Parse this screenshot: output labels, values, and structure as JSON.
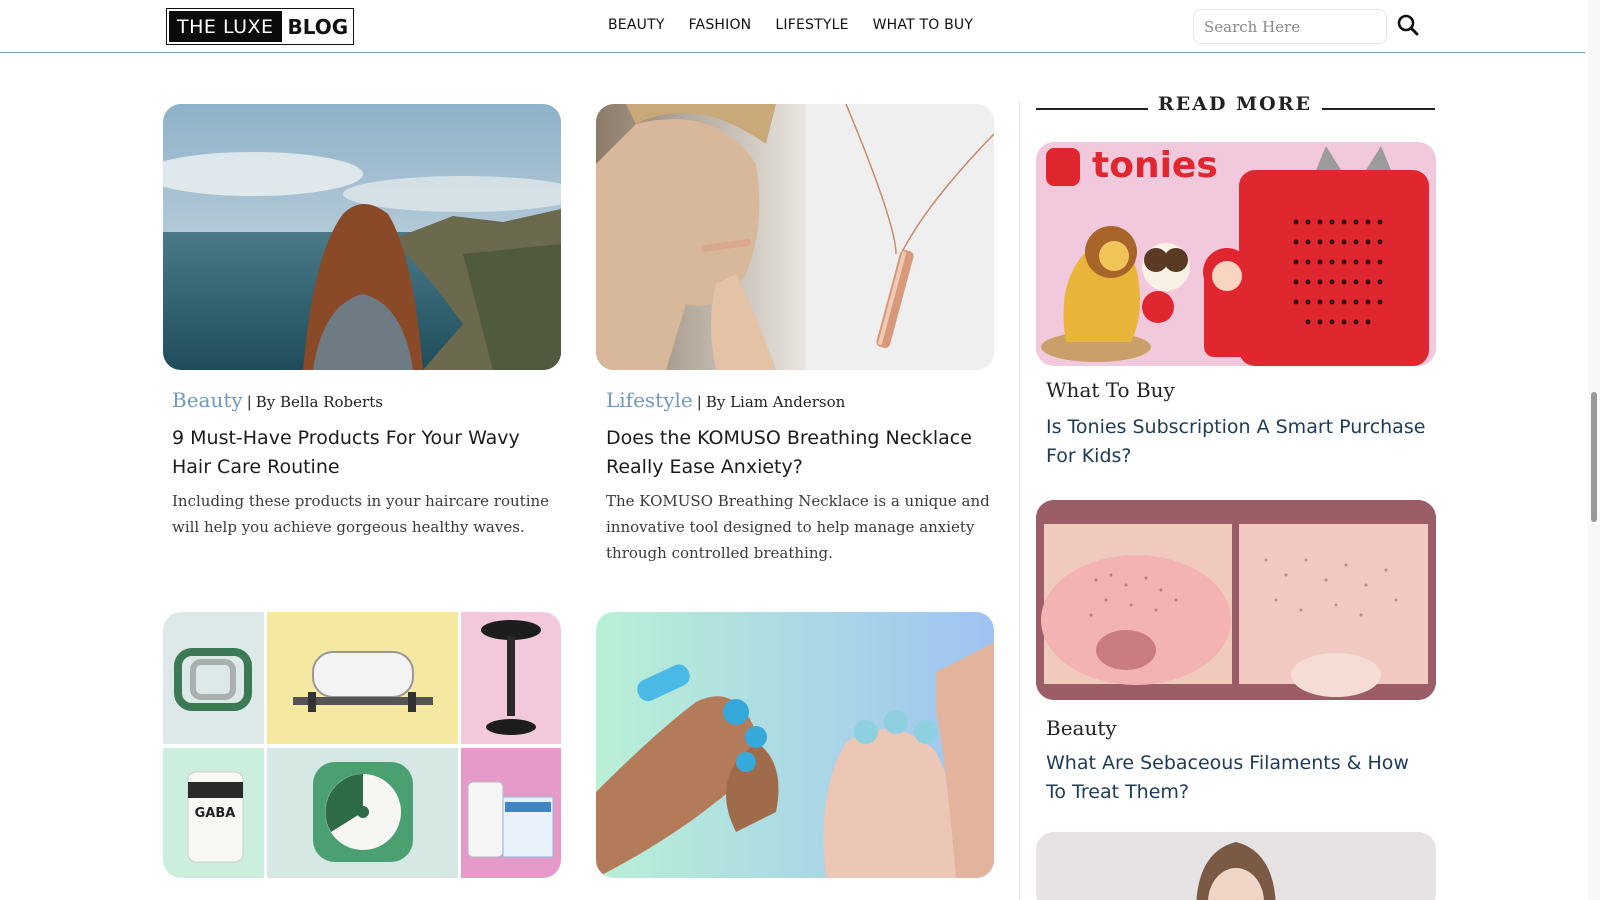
{
  "header": {
    "logo_part1": "THE LUXE",
    "logo_part2": "BLOG",
    "nav": [
      "BEAUTY",
      "FASHION",
      "LIFESTYLE",
      "WHAT TO BUY"
    ],
    "search_placeholder": "Search Here"
  },
  "cards": [
    {
      "category": "Beauty",
      "author": "By Bella Roberts",
      "title": "9 Must-Have Products For Your Wavy Hair Care Routine",
      "excerpt": "Including these products in your haircare routine will help you achieve gorgeous healthy waves."
    },
    {
      "category": "Lifestyle",
      "author": "By Liam Anderson",
      "title": "Does the KOMUSO Breathing Necklace Really Ease Anxiety?",
      "excerpt": "The KOMUSO Breathing Necklace is a unique and innovative tool designed to help manage anxiety through controlled breathing."
    }
  ],
  "collage": {
    "gaba_label": "GABA"
  },
  "sidebar": {
    "heading": "READ MORE",
    "tonies_brand": "tonies",
    "items": [
      {
        "category": "What To Buy",
        "title": "Is Tonies Subscription A Smart Purchase For Kids?"
      },
      {
        "category": "Beauty",
        "title": "What Are Sebaceous Filaments & How To Treat Them?"
      }
    ]
  },
  "colors": {
    "category_link": "#6f9ac2",
    "header_border": "#7a9bb3",
    "tonies_red": "#e0262e",
    "sebaceous_frame": "#9b5e66"
  }
}
